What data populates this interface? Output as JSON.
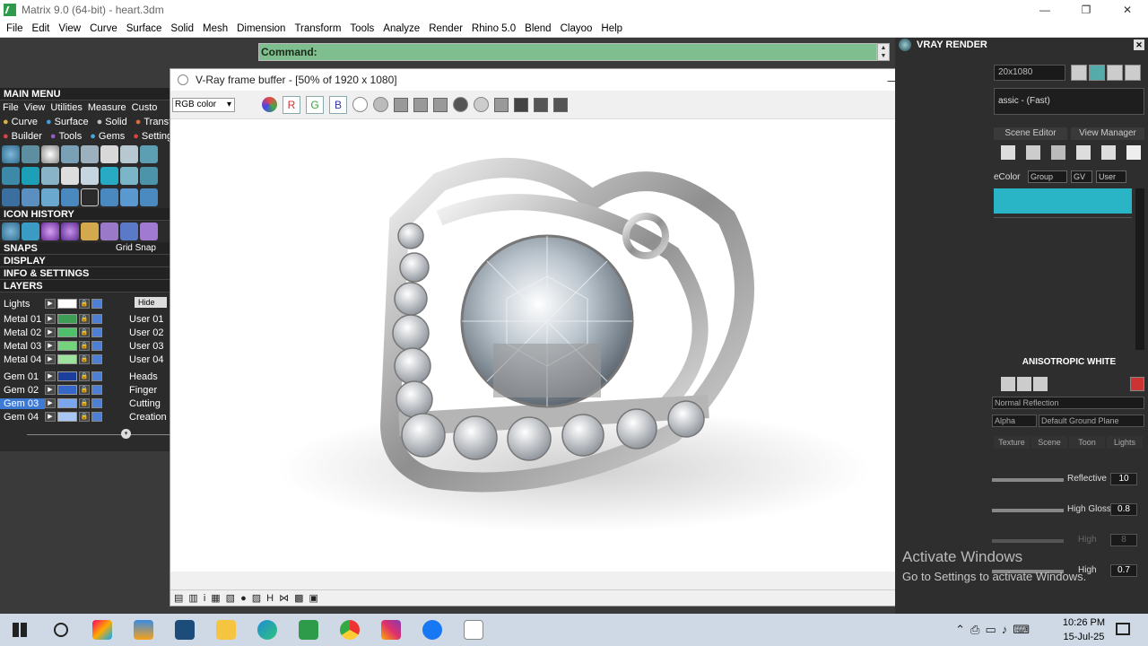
{
  "window": {
    "title": "Matrix 9.0 (64-bit) - heart.3dm",
    "min": "—",
    "max": "❐",
    "close": "✕"
  },
  "menu": [
    "File",
    "Edit",
    "View",
    "Curve",
    "Surface",
    "Solid",
    "Mesh",
    "Dimension",
    "Transform",
    "Tools",
    "Analyze",
    "Render",
    "Rhino 5.0",
    "Blend",
    "Clayoo",
    "Help"
  ],
  "command": {
    "label": "Command:"
  },
  "left": {
    "main_menu": "MAIN MENU",
    "menu_row": [
      "File",
      "View",
      "Utilities",
      "Measure",
      "Custo"
    ],
    "builder_row1": [
      "Curve",
      "Surface",
      "Solid",
      "Transfor"
    ],
    "builder_row2": [
      "Builder",
      "Tools",
      "Gems",
      "Setting"
    ],
    "icon_history": "ICON HISTORY",
    "snaps": "SNAPS",
    "grid_snap": "Grid Snap",
    "display": "DISPLAY",
    "info": "INFO & SETTINGS",
    "layers": "LAYERS",
    "hide": "Hide",
    "layer_rows": [
      {
        "name": "Lights",
        "right": "",
        "color": "#ffffff"
      },
      {
        "name": "Metal 01",
        "right": "User 01",
        "color": "#3f9e55"
      },
      {
        "name": "Metal 02",
        "right": "User 02",
        "color": "#4fbf6a"
      },
      {
        "name": "Metal 03",
        "right": "User 03",
        "color": "#73d47b"
      },
      {
        "name": "Metal 04",
        "right": "User 04",
        "color": "#9ee39d"
      },
      {
        "name": "Gem 01",
        "right": "Heads",
        "color": "#1c3f9e"
      },
      {
        "name": "Gem 02",
        "right": "Finger",
        "color": "#3567c7"
      },
      {
        "name": "Gem 03",
        "right": "Cutting",
        "color": "#7aa6ee"
      },
      {
        "name": "Gem 04",
        "right": "Creation",
        "color": "#a9c7f4"
      }
    ]
  },
  "vray": {
    "title": "V-Ray frame buffer - [50% of 1920 x 1080]",
    "channel": "RGB color",
    "r": "R",
    "g": "G",
    "b": "B",
    "min": "—",
    "max": "☐",
    "close": "✕"
  },
  "right": {
    "title": "VRAY RENDER",
    "resolution": "20x1080",
    "preset": "assic - (Fast)",
    "scene_editor": "Scene Editor",
    "view_manager": "View Manager",
    "ecolor": "eColor",
    "group": "Group",
    "gv": "GV",
    "user": "User",
    "material_name": "ANISOTROPIC WHITE",
    "normal_reflection": "Normal Reflection",
    "alpha": "Alpha",
    "ground": "Default Ground Plane",
    "tabs": [
      "Texture",
      "Scene",
      "Toon",
      "Lights"
    ],
    "reflective_label": "Reflective",
    "reflective_val": "10",
    "gloss_label": "High Gloss",
    "gloss_val": "0.8",
    "high1_label": "High",
    "high1_val": "8",
    "high2_label": "High",
    "high2_val": "0.7"
  },
  "watermark": {
    "line1": "Activate Windows",
    "line2": "Go to Settings to activate Windows."
  },
  "taskbar": {
    "time": "10:26 PM",
    "date": "15-Jul-25"
  }
}
